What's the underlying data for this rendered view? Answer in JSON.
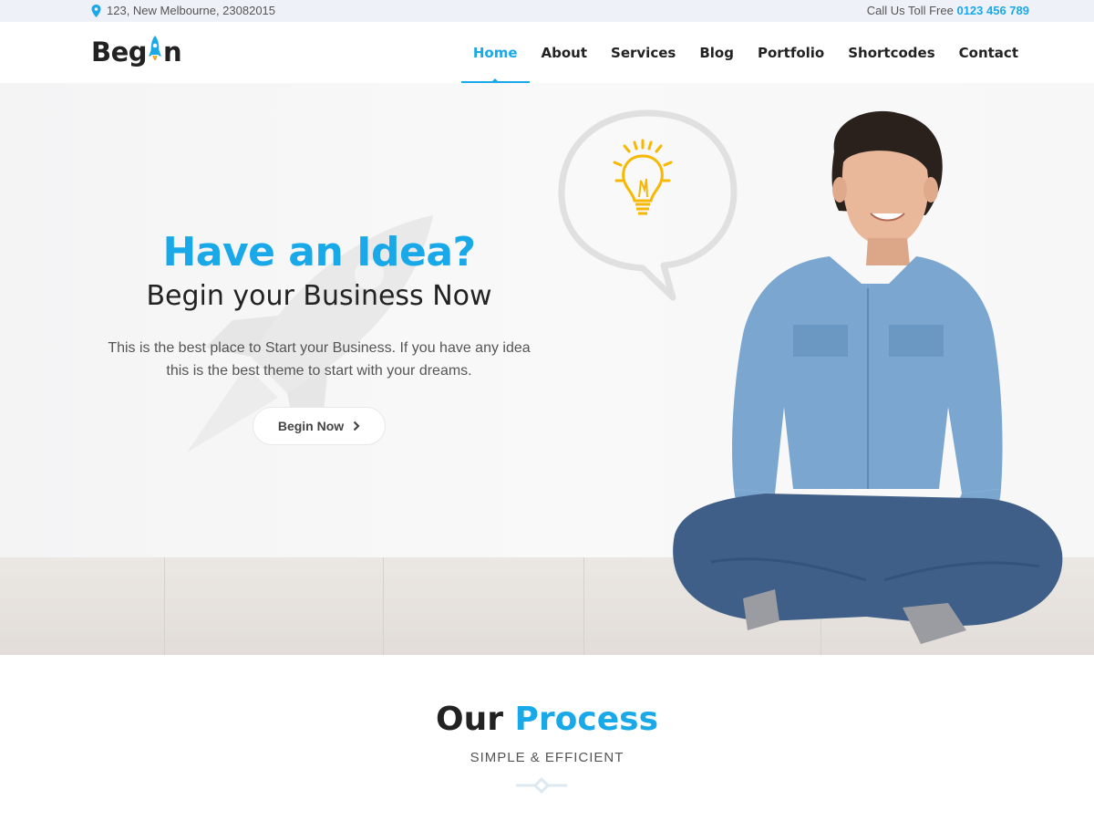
{
  "topbar": {
    "address": "123, New Melbourne, 23082015",
    "call_label": "Call Us Toll Free",
    "phone": "0123 456 789",
    "icons": {
      "location": "map-pin-icon"
    }
  },
  "header": {
    "logo": {
      "text_before": "Beg",
      "text_after": "n",
      "icon": "rocket-icon"
    },
    "nav": [
      {
        "label": "Home",
        "active": true
      },
      {
        "label": "About",
        "active": false
      },
      {
        "label": "Services",
        "active": false
      },
      {
        "label": "Blog",
        "active": false
      },
      {
        "label": "Portfolio",
        "active": false
      },
      {
        "label": "Shortcodes",
        "active": false
      },
      {
        "label": "Contact",
        "active": false
      }
    ]
  },
  "hero": {
    "title": "Have an Idea?",
    "subtitle": "Begin your Business Now",
    "text_line1": "This is the best place to Start your Business. If you have any idea",
    "text_line2": "this is the best theme to start with your dreams.",
    "button_label": "Begin Now",
    "button_icon": "chevron-right-icon",
    "images": {
      "background": "rocket-icon",
      "thought": "lightbulb-icon",
      "person": "man-sitting-photo"
    }
  },
  "process": {
    "title_dark": "Our",
    "title_accent": "Process",
    "subtitle": "SIMPLE & EFFICIENT"
  },
  "colors": {
    "accent": "#1aa9e8",
    "dark": "#222222",
    "topbar_bg": "#eef1f7",
    "bulb": "#f6b800"
  }
}
